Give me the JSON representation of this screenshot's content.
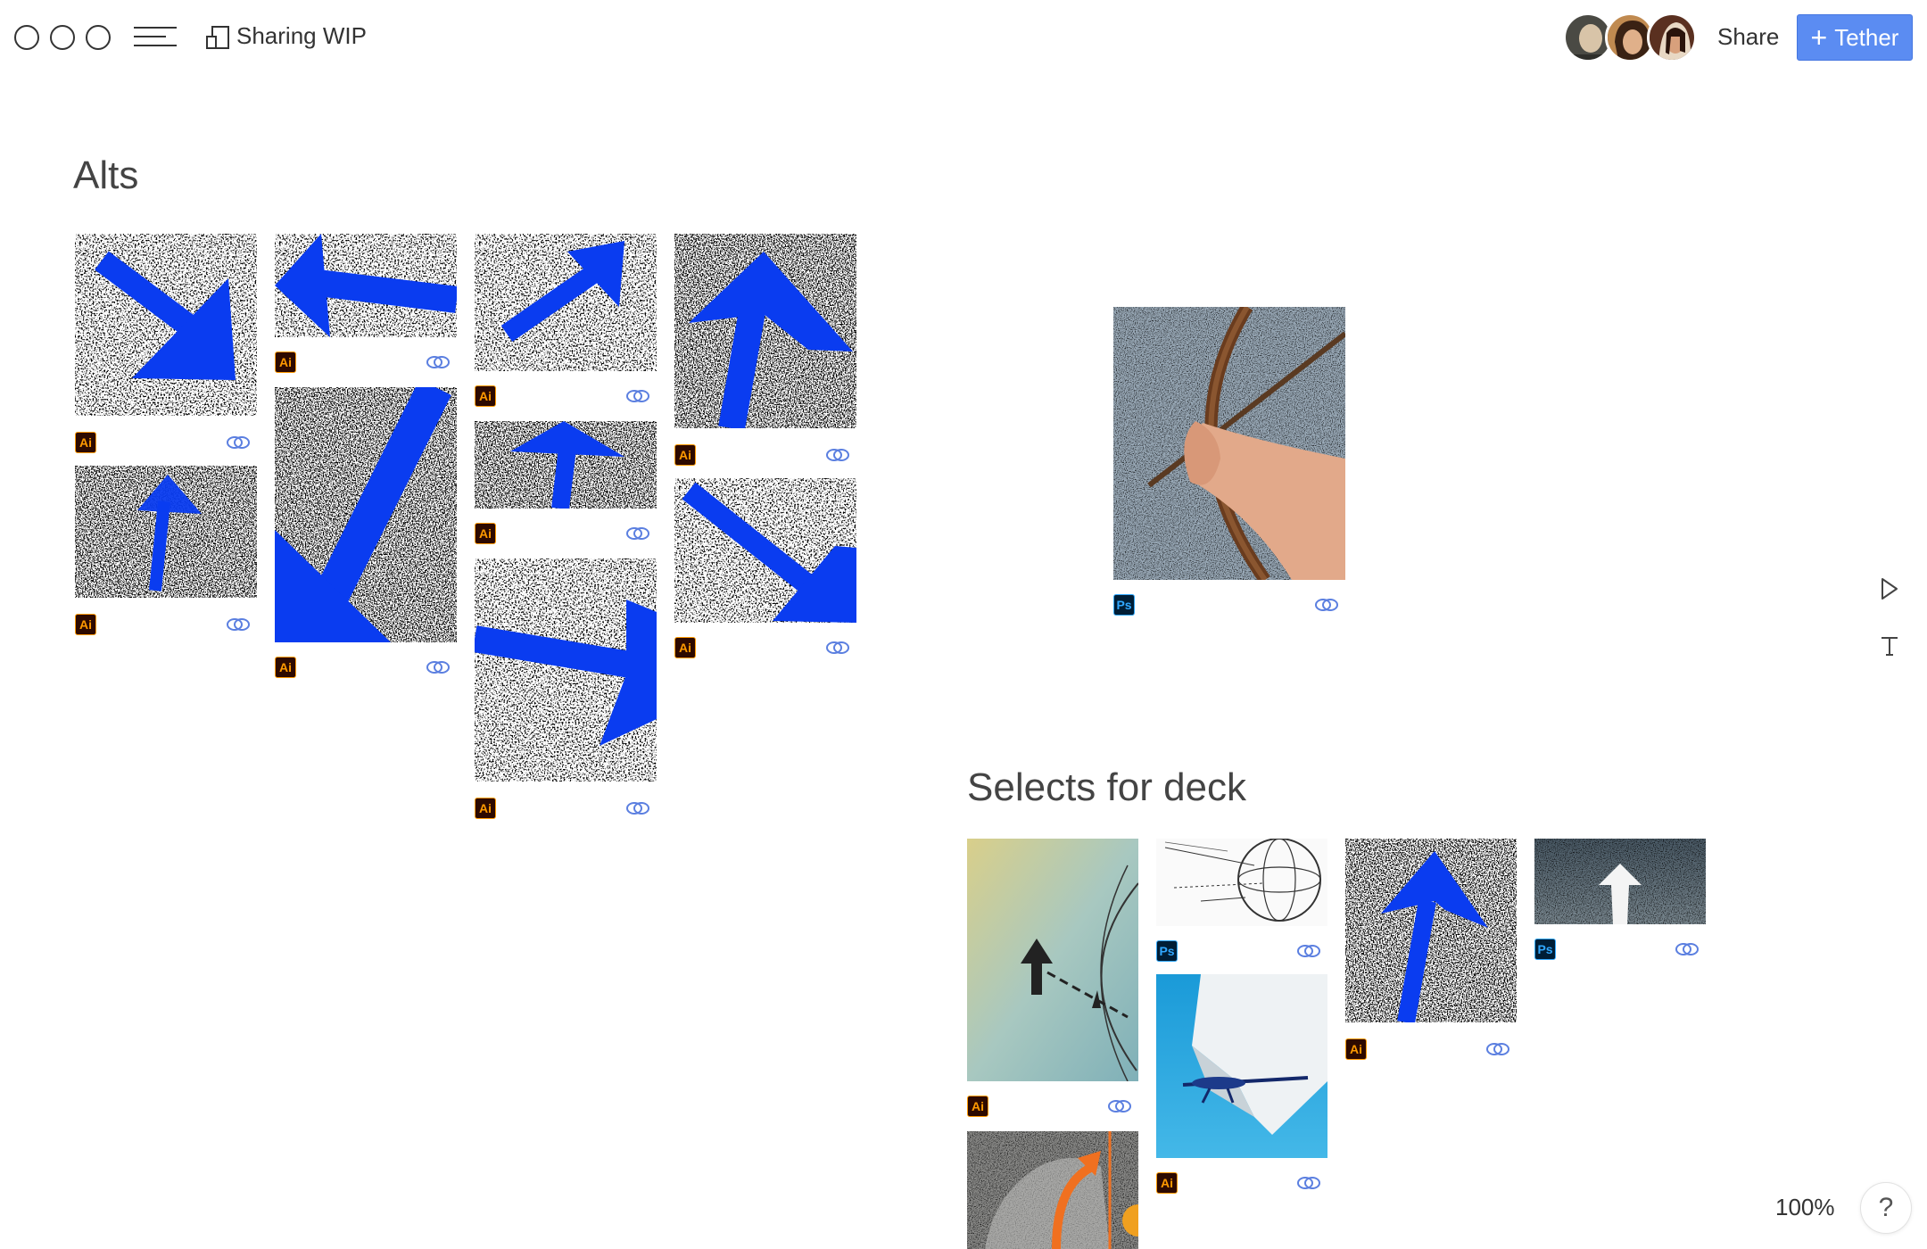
{
  "toolbar": {
    "board_title": "Sharing WIP",
    "share_label": "Share",
    "tether_plus": "+",
    "tether_label": "Tether",
    "collaborators": [
      {
        "name": "collaborator-1",
        "color": "#9a8a78"
      },
      {
        "name": "collaborator-2",
        "color": "#5a3a22"
      },
      {
        "name": "collaborator-3",
        "color": "#3b1f14"
      }
    ]
  },
  "sections": {
    "alts_title": "Alts",
    "selects_title": "Selects for deck"
  },
  "badges": {
    "ai": "Ai",
    "ps": "Ps"
  },
  "colors": {
    "accent": "#5b8cf2",
    "arrow_blue": "#0a3cf0",
    "ai_badge": "#ff9a00",
    "ps_badge": "#31a8ff"
  },
  "zoom": "100%",
  "help": "?"
}
